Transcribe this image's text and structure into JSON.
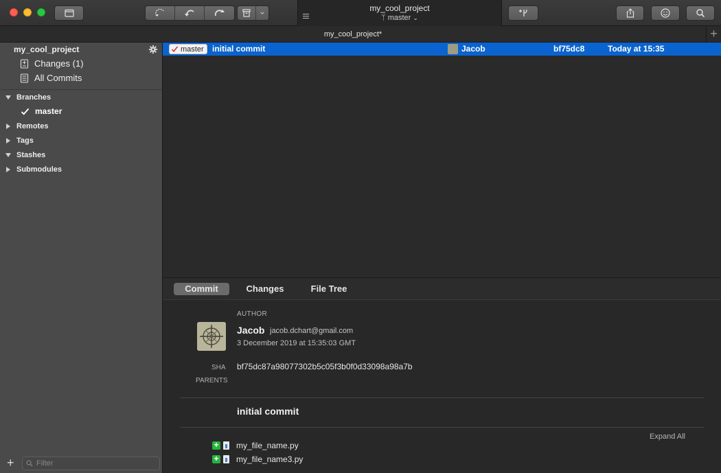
{
  "window": {
    "project_name": "my_cool_project",
    "branch_name": "master",
    "branch_chevron": "⌄"
  },
  "tabbar": {
    "title": "my_cool_project*",
    "add_label": "+"
  },
  "sidebar": {
    "project": "my_cool_project",
    "items": [
      {
        "label": "Changes (1)",
        "icon": "changes-icon"
      },
      {
        "label": "All Commits",
        "icon": "commits-icon"
      }
    ],
    "sections": [
      {
        "label": "Branches",
        "expanded": true
      },
      {
        "label": "Remotes",
        "expanded": false
      },
      {
        "label": "Tags",
        "expanded": false
      },
      {
        "label": "Stashes",
        "expanded": true
      },
      {
        "label": "Submodules",
        "expanded": false
      }
    ],
    "branches": [
      {
        "label": "master",
        "checked": true
      }
    ],
    "filter_placeholder": "Filter",
    "add_label": "+"
  },
  "commits": [
    {
      "ref": "master",
      "message": "initial commit",
      "author": "Jacob",
      "sha_short": "bf75dc8",
      "date": "Today at 15:35",
      "selected": true
    }
  ],
  "detail": {
    "tabs": [
      "Commit",
      "Changes",
      "File Tree"
    ],
    "active_tab": "Commit",
    "author_label": "AUTHOR",
    "author_name": "Jacob",
    "author_email": "jacob.dchart@gmail.com",
    "date": "3 December 2019 at 15:35:03 GMT",
    "sha_label": "SHA",
    "sha": "bf75dc87a98077302b5c05f3b0f0d33098a98a7b",
    "parents_label": "PARENTS",
    "message": "initial commit",
    "expand_all": "Expand All",
    "files": [
      {
        "name": "my_file_name.py",
        "status": "added"
      },
      {
        "name": "my_file_name3.py",
        "status": "added"
      }
    ]
  },
  "colors": {
    "selection": "#0a63cf",
    "added": "#27b33e",
    "close": "#fe5f57",
    "minimize": "#febc2e",
    "zoom": "#28c840"
  }
}
